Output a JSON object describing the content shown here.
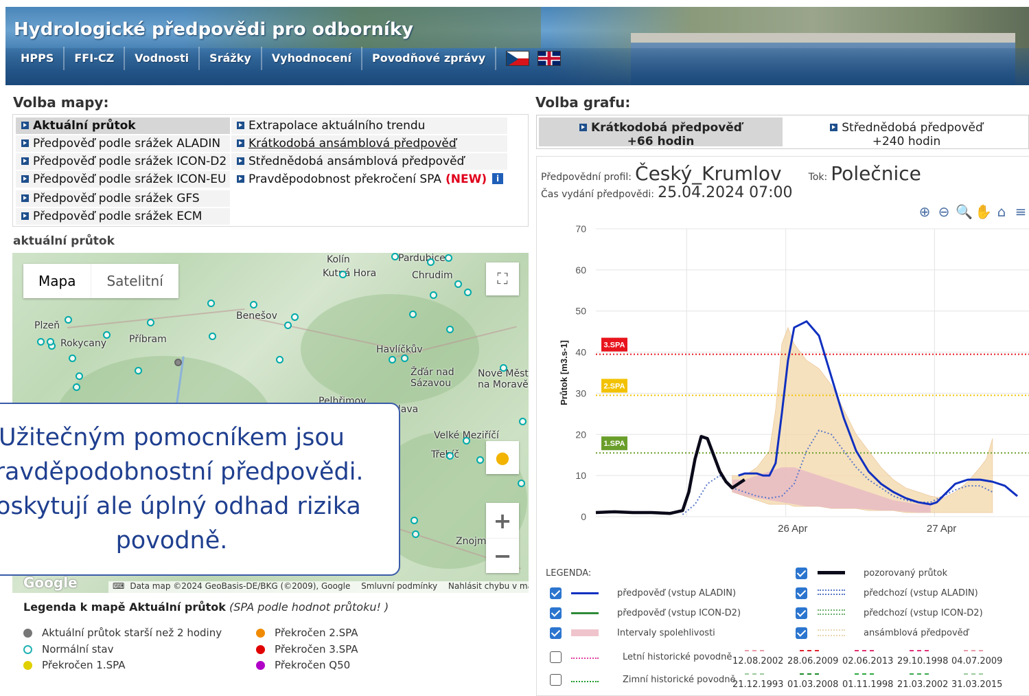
{
  "site": {
    "title": "Hydrologické předpovědi pro odborníky",
    "nav": [
      "HPPS",
      "FFI-CZ",
      "Vodnosti",
      "Srážky",
      "Vyhodnocení",
      "Povodňové zprávy"
    ]
  },
  "map_section": {
    "heading": "Volba mapy:",
    "items_left": [
      "Aktuální průtok",
      "Předpověď podle srážek ALADIN",
      "Předpověď podle srážek ICON-D2",
      "Předpověď podle srážek ICON-EU",
      "Předpověď podle srážek GFS",
      "Předpověď podle srážek ECM"
    ],
    "items_right": [
      "Extrapolace aktuálního trendu",
      "Krátkodobá ansámblová předpověď",
      "Střednědobá ansámblová předpověď",
      "Pravděpodobnost překročení SPA"
    ],
    "new_badge": "(NEW)",
    "info_icon_text": "i",
    "current_map_heading": "aktuální průtok"
  },
  "map": {
    "type_options": [
      "Mapa",
      "Satelitní"
    ],
    "places": [
      {
        "name": "Kolín",
        "x": 458,
        "y": 2
      },
      {
        "name": "Pardubice",
        "x": 562,
        "y": 0
      },
      {
        "name": "Kutná Hora",
        "x": 452,
        "y": 22
      },
      {
        "name": "Chrudim",
        "x": 582,
        "y": 25
      },
      {
        "name": "Benešov",
        "x": 326,
        "y": 84
      },
      {
        "name": "Plzeň",
        "x": 32,
        "y": 98
      },
      {
        "name": "Rokycany",
        "x": 70,
        "y": 124
      },
      {
        "name": "Příbram",
        "x": 170,
        "y": 118
      },
      {
        "name": "Havlíčkův",
        "x": 530,
        "y": 133
      },
      {
        "name": "Žďár nad",
        "x": 580,
        "y": 166
      },
      {
        "name": "Sázavou",
        "x": 580,
        "y": 182
      },
      {
        "name": "Nové Město",
        "x": 678,
        "y": 168
      },
      {
        "name": "na Moravě",
        "x": 678,
        "y": 184
      },
      {
        "name": "Pelhřimov",
        "x": 446,
        "y": 208
      },
      {
        "name": "Jihlava",
        "x": 545,
        "y": 220
      },
      {
        "name": "Velké Meziříčí",
        "x": 614,
        "y": 258
      },
      {
        "name": "Třebíč",
        "x": 610,
        "y": 286
      },
      {
        "name": "Znojmo",
        "x": 646,
        "y": 412
      }
    ],
    "attribution": [
      "Data map ©2024 GeoBasis-DE/BKG (©2009), Google",
      "Smluvní podmínky",
      "Nahlásit chybu v mapě"
    ],
    "google": "Google"
  },
  "map_legend": {
    "title_bold": "Legenda k mapě Aktuální průtok",
    "title_italic": "(SPA podle hodnot průtoku! )",
    "items": [
      {
        "label": "Aktuální průtok starší než 2 hodiny",
        "color": "#777777"
      },
      {
        "label": "Normální stav",
        "color": "#22b3b3"
      },
      {
        "label": "Překročen 1.SPA",
        "color": "#e0d000"
      },
      {
        "label": "Překročen 2.SPA",
        "color": "#f08a00"
      },
      {
        "label": "Překročen 3.SPA",
        "color": "#e00000"
      },
      {
        "label": "Překročen Q50",
        "color": "#b000c8"
      }
    ]
  },
  "callout": {
    "lines": [
      "Užitečným pomocníkem jsou",
      "pravděpodobnostní předpovědi.",
      "Poskytují ale úplný odhad rizika",
      "povodně."
    ]
  },
  "graph_section": {
    "heading": "Volba grafu:",
    "tabs": [
      {
        "line1": "Krátkodobá předpověď",
        "line2": "+66 hodin"
      },
      {
        "line1": "Střednědobá předpověď",
        "line2": "+240 hodin"
      }
    ],
    "profile_label": "Předpovědní profil:",
    "profile_value": "Český_Krumlov",
    "river_label": "Tok:",
    "river_value": "Polečnice",
    "issue_label": "Čas vydání předpovědi:",
    "issue_value": "25.04.2024 07:00",
    "toolbar_icons": [
      "zoom-in-icon",
      "zoom-out-icon",
      "zoom-select-icon",
      "pan-icon",
      "home-icon",
      "menu-icon"
    ]
  },
  "chart_data": {
    "type": "line",
    "ylabel": "Průtok [m3.s-1]",
    "ylim": [
      0,
      70
    ],
    "yticks": [
      0,
      10,
      20,
      30,
      40,
      50,
      60,
      70
    ],
    "xticks": [
      "26 Apr",
      "27 Apr"
    ],
    "thresholds": [
      {
        "name": "3.SPA",
        "value": 39.5,
        "color": "#e8141c"
      },
      {
        "name": "2.SPA",
        "value": 29.5,
        "color": "#f2c200"
      },
      {
        "name": "1.SPA",
        "value": 15.5,
        "color": "#6a9e2a"
      }
    ],
    "x_hours_note": "x in hours since 25 Apr 00:00",
    "observed": {
      "name": "pozorovaný průtok",
      "color": "#0a0a1a",
      "x": [
        0,
        3,
        6,
        9,
        12,
        14,
        15,
        16,
        17,
        18,
        19,
        20,
        21,
        22,
        23,
        24
      ],
      "y": [
        1,
        1.2,
        1,
        1,
        0.8,
        1.5,
        6,
        14,
        19.5,
        19,
        15,
        11,
        8.5,
        7,
        8,
        9
      ]
    },
    "forecast_aladin": {
      "name": "předpověď (vstup ALADIN)",
      "color": "#1030c0",
      "x": [
        23,
        24,
        26,
        27,
        28,
        29,
        30,
        31,
        32,
        34,
        36,
        38,
        40,
        42,
        44,
        46,
        48,
        50,
        52,
        54,
        55,
        56,
        58,
        60,
        62,
        64,
        66,
        68
      ],
      "y": [
        10,
        10.5,
        10.5,
        10,
        10,
        13,
        25,
        38,
        46,
        47.5,
        44,
        34,
        24,
        16,
        11,
        8,
        6,
        4.5,
        3.5,
        3,
        3.5,
        5,
        8,
        9,
        9,
        8.5,
        7.5,
        5
      ]
    },
    "ensemble_band": {
      "name": "ansámblová předpověď",
      "color": "#f3d7a8",
      "x": [
        22,
        24,
        26,
        28,
        29,
        30,
        31,
        32,
        34,
        36,
        38,
        40,
        42,
        44,
        46,
        48,
        50,
        52,
        54,
        56,
        58,
        60,
        62,
        63,
        64
      ],
      "lower": [
        6,
        5,
        4,
        3,
        3,
        3,
        3,
        2.5,
        2.5,
        2.5,
        2,
        2,
        2,
        1.5,
        1.5,
        1.5,
        1,
        1,
        1,
        1,
        1,
        1,
        1,
        1,
        1
      ],
      "upper": [
        10,
        10,
        12,
        16,
        26,
        42,
        46,
        42,
        38,
        36,
        32,
        26,
        20,
        16,
        12,
        9,
        7,
        6,
        5,
        4.5,
        6,
        8.5,
        12,
        14,
        19
      ]
    },
    "confidence_band": {
      "name": "Intervaly spolehlivosti",
      "color": "#e6b4c4",
      "x": [
        22,
        24,
        26,
        28,
        30,
        32,
        34,
        36,
        38,
        40,
        42,
        44,
        46,
        48,
        50,
        52,
        54
      ],
      "lower": [
        6,
        5,
        4.5,
        4,
        3.5,
        3,
        2.5,
        2.5,
        2,
        2,
        2,
        1.8,
        1.5,
        1.5,
        1.2,
        1,
        1
      ],
      "upper": [
        9,
        9,
        10,
        11,
        12,
        12,
        11,
        10,
        9,
        8,
        7,
        6,
        5,
        4,
        3.5,
        3,
        3
      ]
    },
    "previous_aladin": {
      "name": "předchozí (vstup ALADIN)",
      "color": "#5a78c8",
      "x": [
        14,
        16,
        18,
        20,
        22,
        24,
        26,
        28,
        30,
        32,
        34,
        36,
        38,
        40,
        42,
        44,
        46,
        48,
        50,
        52,
        54,
        56,
        58,
        60,
        62,
        64
      ],
      "y": [
        0.5,
        3,
        8,
        10,
        7,
        6,
        5,
        4.5,
        5,
        8,
        16,
        21,
        20,
        16,
        12,
        9,
        7,
        5,
        4,
        3.5,
        3.5,
        5,
        6.5,
        7.5,
        7.5,
        6
      ]
    },
    "previous_icond2": {
      "name": "předchozí (vstup ICON-D2)",
      "color": "#6fb06f",
      "x": [],
      "y": []
    }
  },
  "chart_legend": {
    "title": "LEGENDA:",
    "items": [
      {
        "label": "předpověď (vstup ALADIN)",
        "checked": true
      },
      {
        "label": "předpověď (vstup ICON-D2)",
        "checked": true
      },
      {
        "label": "Intervaly spolehlivosti",
        "checked": true
      },
      {
        "label": "pozorovaný průtok",
        "checked": true
      },
      {
        "label": "předchozí (vstup ALADIN)",
        "checked": true
      },
      {
        "label": "předchozí (vstup ICON-D2)",
        "checked": true
      },
      {
        "label": "ansámblová předpověď",
        "checked": true
      }
    ],
    "summer_label": "Letní historické povodně",
    "winter_label": "Zimní historické povodně",
    "summer_dates": [
      "12.08.2002",
      "28.06.2009",
      "02.06.2013",
      "29.10.1998",
      "04.07.2009"
    ],
    "winter_dates": [
      "21.12.1993",
      "01.03.2008",
      "01.11.1998",
      "21.03.2002",
      "31.03.2015"
    ],
    "summer_colors": [
      "#e89aa8",
      "#e0202e",
      "#e03070",
      "#e0307a",
      "#e89aa8"
    ],
    "winter_colors": [
      "#9ac99a",
      "#1d8a2a",
      "#2aa83a",
      "#3aa850",
      "#9ac99a"
    ]
  }
}
